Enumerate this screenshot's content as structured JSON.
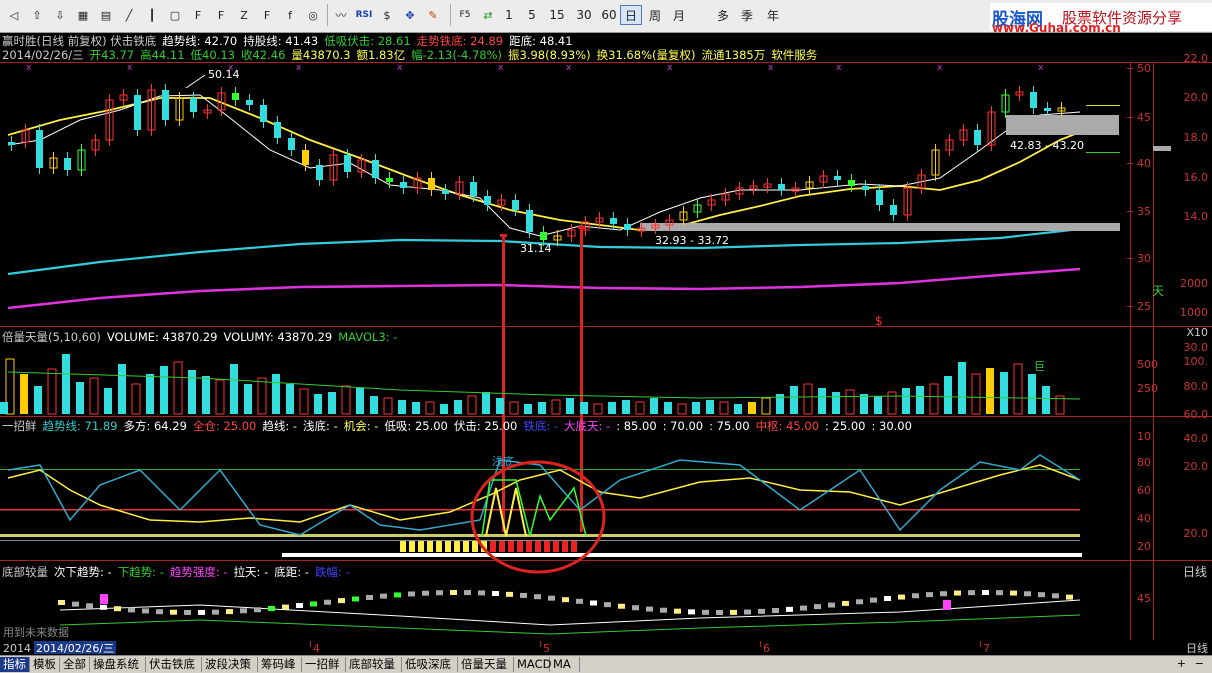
{
  "toolbar": {
    "periods": [
      "1",
      "5",
      "15",
      "30",
      "60",
      "日",
      "周",
      "月",
      "多",
      "季",
      "年"
    ],
    "active_period": "日",
    "rsi_label": "RSI",
    "f5_label": "F5"
  },
  "logo": {
    "brand": "股海网",
    "slogan": "股票软件资源分享",
    "url": "www.Guhai.com.cn"
  },
  "header": {
    "line1": [
      {
        "text": "赢时胜(日线 前复权) 伏击铁底",
        "color": "#cccccc"
      },
      {
        "text": "趋势线: 42.70",
        "color": "#ffffff"
      },
      {
        "text": "持股线: 41.43",
        "color": "#ffffff"
      },
      {
        "text": "低吸伏击: 28.61",
        "color": "#33cc33"
      },
      {
        "text": "走势铁底: 24.89",
        "color": "#ff4444"
      },
      {
        "text": "距底: 48.41",
        "color": "#ffffff"
      }
    ],
    "line2": [
      {
        "text": "2014/02/26/三",
        "color": "#cccccc"
      },
      {
        "text": "开43.77",
        "color": "#33cc33"
      },
      {
        "text": "高44.11",
        "color": "#33cc33"
      },
      {
        "text": "低40.13",
        "color": "#33cc33"
      },
      {
        "text": "收42.46",
        "color": "#33cc33"
      },
      {
        "text": "量43870.3",
        "color": "#ffff55"
      },
      {
        "text": "额1.83亿",
        "color": "#ffff55"
      },
      {
        "text": "幅-2.13(-4.78%)",
        "color": "#33cc33"
      },
      {
        "text": "振3.98(8.93%)",
        "color": "#ffff55"
      },
      {
        "text": "换31.68%(量复权)",
        "color": "#ffff55"
      },
      {
        "text": "流通1385万",
        "color": "#ffff55"
      },
      {
        "text": "软件服务",
        "color": "#ffff55"
      }
    ]
  },
  "main_chart": {
    "price_axis": [
      "50",
      "45",
      "40",
      "35",
      "30",
      "25"
    ],
    "right_axis": [
      "22.0",
      "20.0",
      "18.0",
      "16.0",
      "14.0",
      "2000",
      "1000",
      "X10"
    ],
    "annotations": {
      "high": "50.14",
      "low": "31.14",
      "range1": "32.93 - 33.72",
      "range2": "42.83 - 43.20",
      "s_mark": "$",
      "side_label": "天"
    }
  },
  "volume_panel": {
    "title": [
      {
        "text": "倍量天量(5,10,60)",
        "color": "#cccccc"
      },
      {
        "text": "VOLUME: 43870.29",
        "color": "#ffffff"
      },
      {
        "text": "VOLUMY: 43870.29",
        "color": "#ffffff"
      },
      {
        "text": "MAVOL3: -",
        "color": "#33cc33"
      }
    ],
    "axis": [
      "500",
      "250"
    ],
    "right_axis": [
      "30.0",
      "100.",
      "80.0",
      "60.0"
    ],
    "tag": "巨"
  },
  "indicator_panel": {
    "title": [
      {
        "text": "一招鲜",
        "color": "#cccccc"
      },
      {
        "text": "趋势线: 71.89",
        "color": "#33cccc"
      },
      {
        "text": "多方: 64.29",
        "color": "#ffffff"
      },
      {
        "text": "全仓: 25.00",
        "color": "#ff4444"
      },
      {
        "text": "趋线: -",
        "color": "#ffffff"
      },
      {
        "text": "浅底: -",
        "color": "#ffffff"
      },
      {
        "text": "机会: -",
        "color": "#ffff55"
      },
      {
        "text": "低吸: 25.00",
        "color": "#ffffff"
      },
      {
        "text": "伏击: 25.00",
        "color": "#ffffff"
      },
      {
        "text": "铁底: -",
        "color": "#4444ff"
      },
      {
        "text": "大底天: -",
        "color": "#ff44ff"
      },
      {
        "text": ": 85.00",
        "color": "#ffffff"
      },
      {
        "text": ": 70.00",
        "color": "#ffffff"
      },
      {
        "text": ": 75.00",
        "color": "#ffffff"
      },
      {
        "text": "中枢: 45.00",
        "color": "#ff4444"
      },
      {
        "text": ": 25.00",
        "color": "#ffffff"
      },
      {
        "text": ": 30.00",
        "color": "#ffffff"
      }
    ],
    "axis": [
      "10",
      "80",
      "60",
      "40",
      "20"
    ],
    "right_axis": [
      "40.0",
      "20.0",
      "20.0"
    ],
    "tag": "浅底"
  },
  "bottom_panel": {
    "title": [
      {
        "text": "底部较量",
        "color": "#cccccc"
      },
      {
        "text": "次下趋势: -",
        "color": "#ffffff"
      },
      {
        "text": "下趋势: -",
        "color": "#33cc33"
      },
      {
        "text": "趋势强度: -",
        "color": "#ff44ff"
      },
      {
        "text": "拉天: -",
        "color": "#ffffff"
      },
      {
        "text": "底距: -",
        "color": "#ffffff"
      },
      {
        "text": "跌幅: -",
        "color": "#4444ff"
      }
    ],
    "axis": [
      "45"
    ],
    "right_label": "日线",
    "watermark": "用到未来数据"
  },
  "date_axis": {
    "labels": [
      "4",
      "5",
      "6",
      "7"
    ],
    "current": "2014/02/26/三",
    "year_prefix": "2014",
    "right_label": "日线"
  },
  "status_tabs": [
    "指标",
    "模板",
    "全部",
    "操盘系统",
    "伏击铁底",
    "波段决策",
    "筹码峰",
    "一招鲜",
    "底部较量",
    "低吸深底",
    "倍量天量",
    "MACD",
    "MA"
  ],
  "active_tab": "指标"
}
